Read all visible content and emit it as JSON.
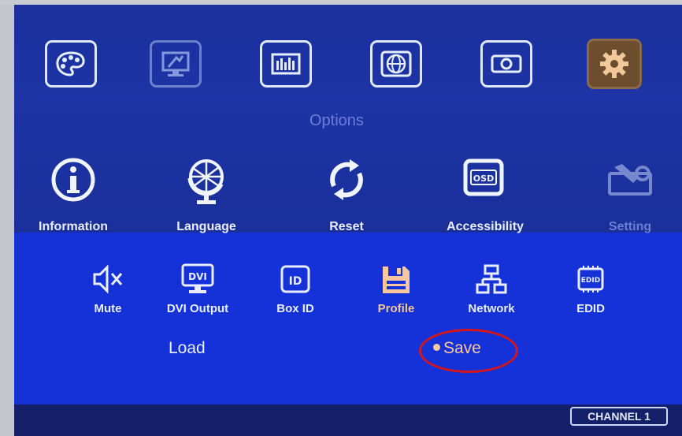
{
  "menu": {
    "title": "Options",
    "top_icons": [
      {
        "icon": "palette-icon"
      },
      {
        "icon": "monitor-settings-icon"
      },
      {
        "icon": "equalizer-icon"
      },
      {
        "icon": "globe-icon"
      },
      {
        "icon": "projector-icon"
      },
      {
        "icon": "gear-icon",
        "active": true
      }
    ],
    "categories": [
      {
        "label": "Information",
        "icon": "info-icon"
      },
      {
        "label": "Language",
        "icon": "globe-icon"
      },
      {
        "label": "Reset",
        "icon": "reset-icon"
      },
      {
        "label": "Accessibility",
        "icon": "osd-icon"
      },
      {
        "label": "Setting",
        "icon": "wrench-icon",
        "dimmed": true
      }
    ],
    "sub_items": [
      {
        "label": "Mute",
        "icon": "mute-icon"
      },
      {
        "label": "DVI Output",
        "icon": "dvi-icon"
      },
      {
        "label": "Box ID",
        "icon": "id-icon"
      },
      {
        "label": "Profile",
        "icon": "floppy-icon",
        "selected": true
      },
      {
        "label": "Network",
        "icon": "network-icon"
      },
      {
        "label": "EDID",
        "icon": "edid-icon"
      }
    ],
    "profile_options": [
      {
        "label": "Load"
      },
      {
        "label": "Save",
        "selected": true
      }
    ],
    "channel": "CHANNEL 1"
  },
  "colors": {
    "accent": "#f7c79d",
    "highlight_circle": "#d4161c",
    "panel": "#1532d8"
  }
}
